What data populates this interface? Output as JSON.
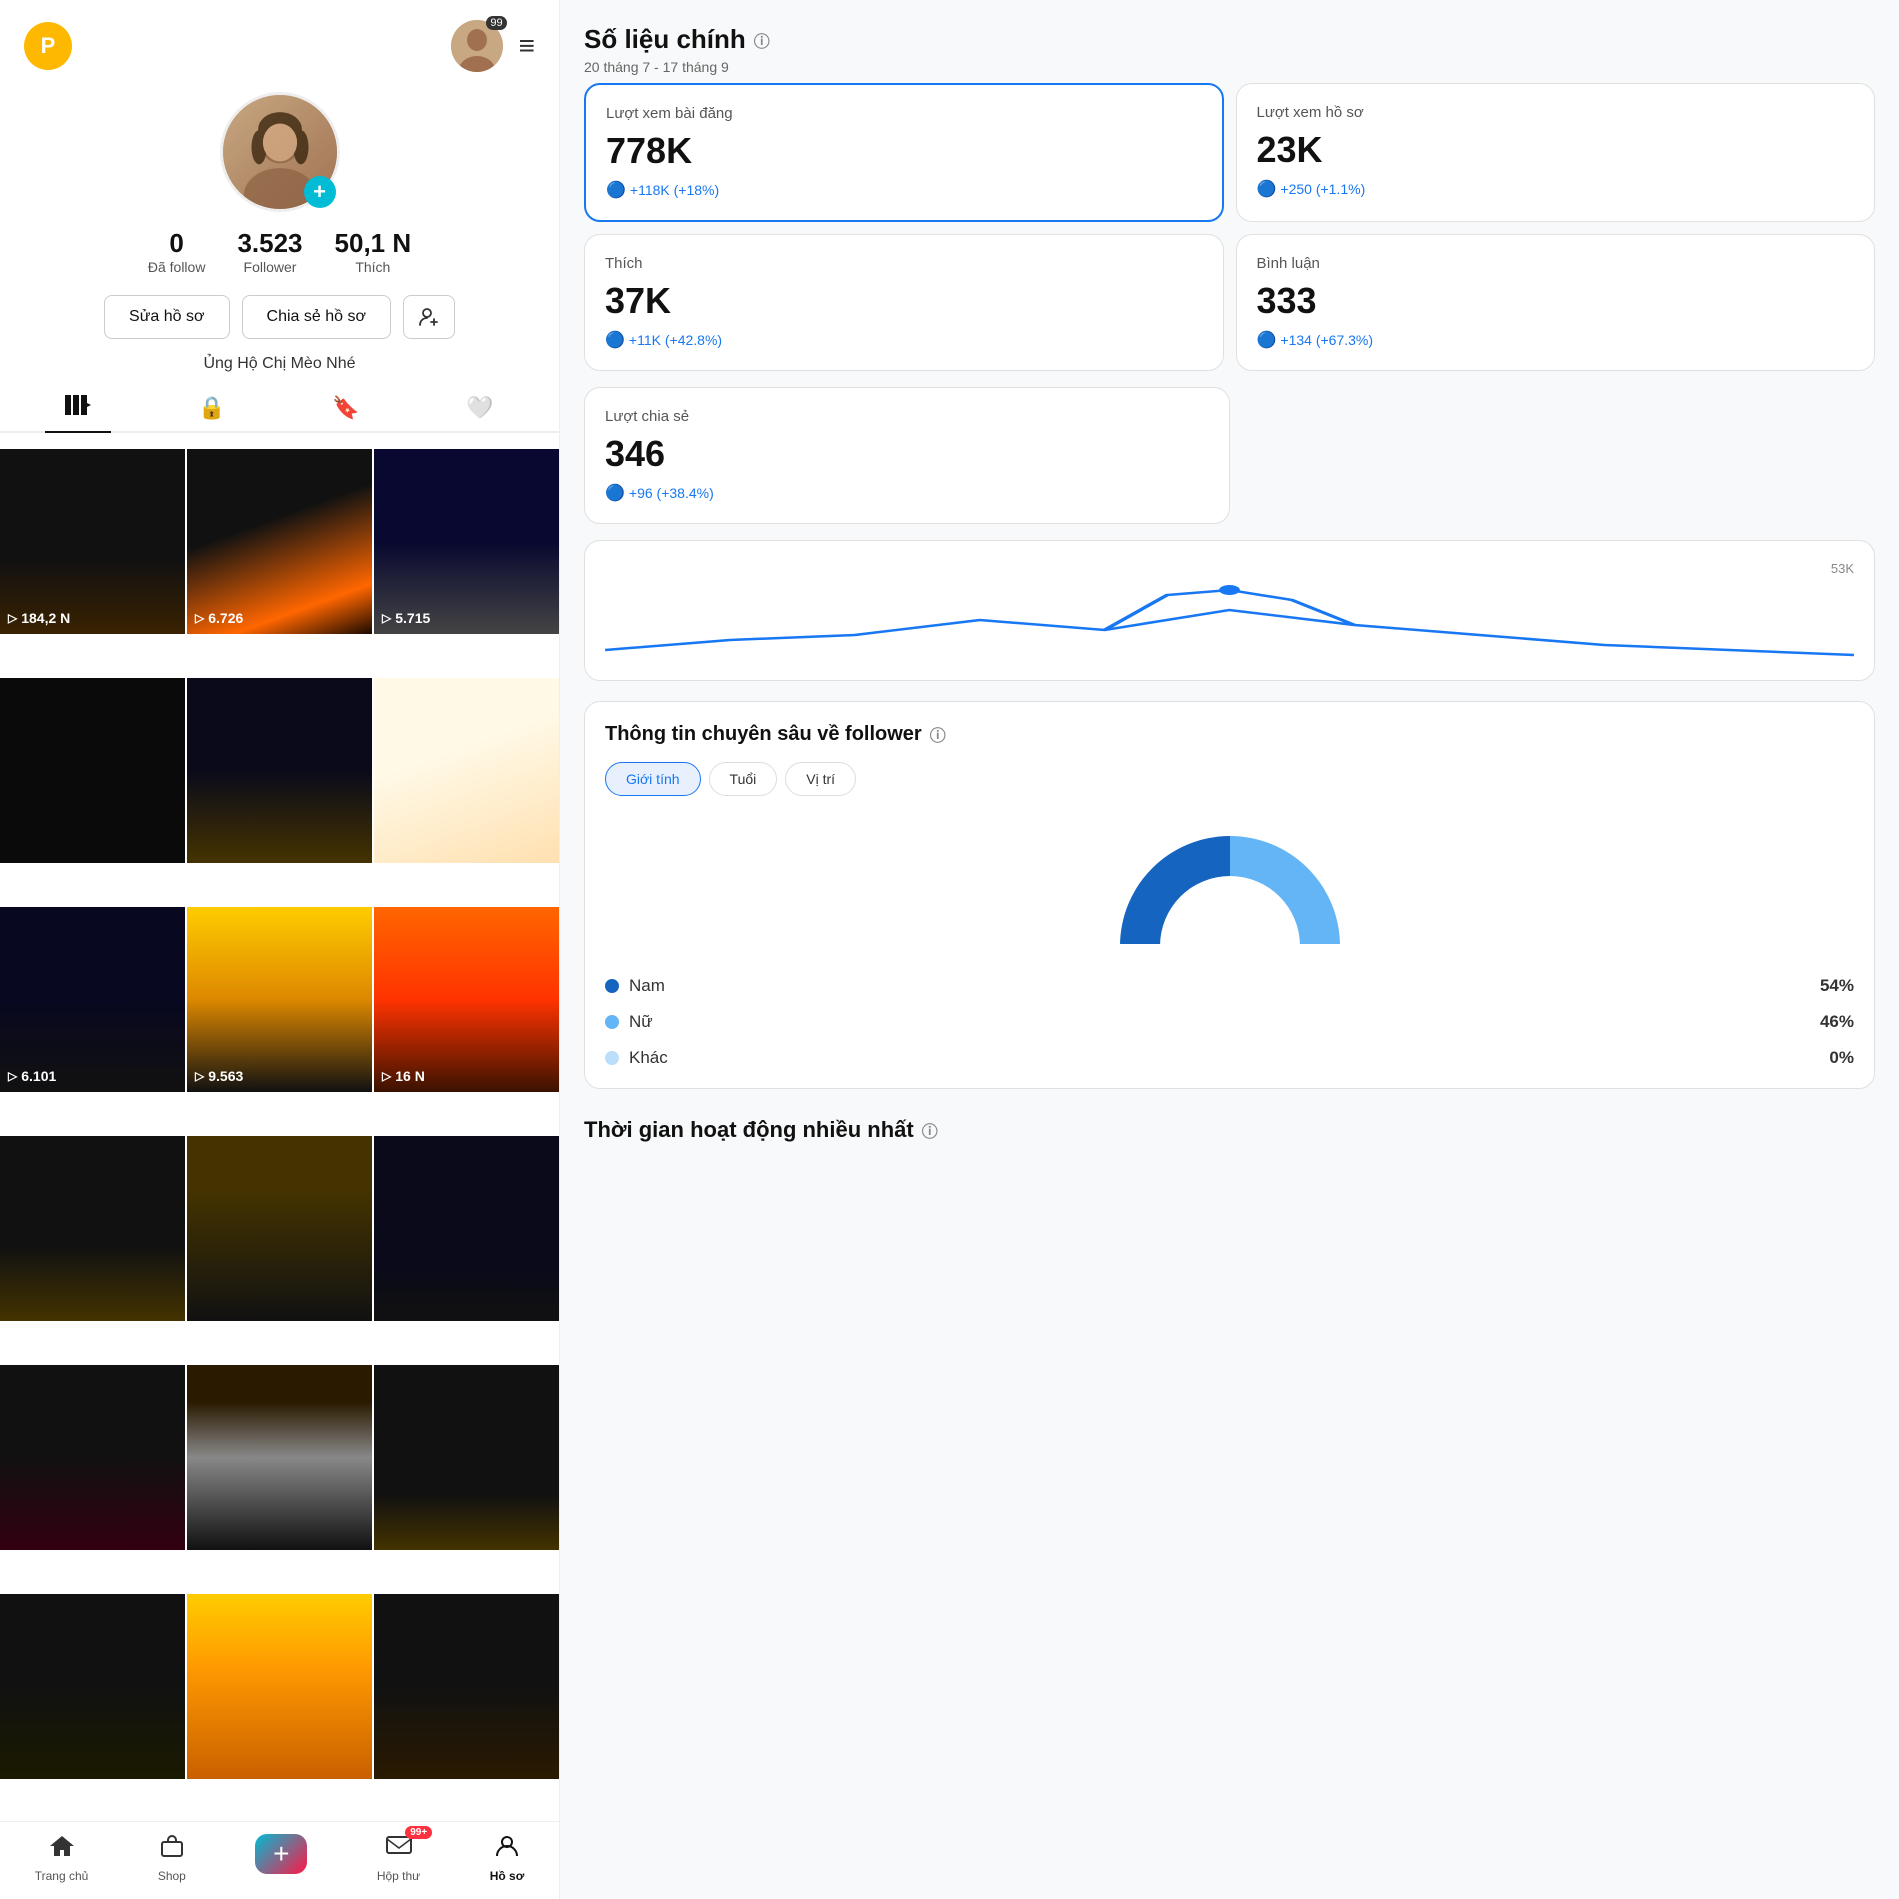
{
  "app": {
    "premium_label": "P",
    "notification_count": "99",
    "hamburger": "≡"
  },
  "profile": {
    "add_button": "+",
    "stats": {
      "follow_value": "0",
      "follow_label": "Đã follow",
      "follower_value": "3.523",
      "follower_label": "Follower",
      "likes_value": "50,1 N",
      "likes_label": "Thích"
    },
    "buttons": {
      "edit": "Sửa hồ sơ",
      "share": "Chia sẻ hồ sơ",
      "add_friend": "👤+"
    },
    "bio": "Ủng Hộ Chị Mèo Nhé",
    "tabs": [
      "|||▾",
      "🔒",
      "🔖",
      "❤"
    ]
  },
  "videos": [
    {
      "count": "184,2 N",
      "class": "vc1"
    },
    {
      "count": "6.726",
      "class": "vc2"
    },
    {
      "count": "5.715",
      "class": "vc3"
    },
    {
      "count": "",
      "class": "vc4"
    },
    {
      "count": "",
      "class": "vc5"
    },
    {
      "count": "",
      "class": "vc6"
    },
    {
      "count": "6.101",
      "class": "vc7"
    },
    {
      "count": "9.563",
      "class": "vc8"
    },
    {
      "count": "16 N",
      "class": "vc9"
    },
    {
      "count": "",
      "class": "vc10"
    },
    {
      "count": "",
      "class": "vc11"
    },
    {
      "count": "",
      "class": "vc12"
    },
    {
      "count": "",
      "class": "vc13"
    },
    {
      "count": "",
      "class": "vc14"
    },
    {
      "count": "",
      "class": "vc15"
    },
    {
      "count": "",
      "class": "vc16"
    },
    {
      "count": "",
      "class": "vc17"
    },
    {
      "count": "",
      "class": "vc18"
    }
  ],
  "bottom_nav": [
    {
      "icon": "🏠",
      "label": "Trang chủ",
      "active": false
    },
    {
      "icon": "🛍",
      "label": "Shop",
      "active": false
    },
    {
      "icon": "+",
      "label": "",
      "active": false,
      "is_plus": true
    },
    {
      "icon": "📬",
      "label": "Hộp thư",
      "active": false,
      "badge": "99+"
    },
    {
      "icon": "👤",
      "label": "Hồ sơ",
      "active": true
    }
  ],
  "right": {
    "section_title": "Số liệu chính",
    "date_range": "20 tháng 7 - 17 tháng 9",
    "metrics": [
      {
        "label": "Lượt xem bài đăng",
        "value": "778K",
        "change": "+118K (+18%)",
        "highlighted": true
      },
      {
        "label": "Lượt xem hồ sơ",
        "value": "23K",
        "change": "+250 (+1.1%)",
        "highlighted": false
      },
      {
        "label": "Thích",
        "value": "37K",
        "change": "+11K (+42.8%)",
        "highlighted": false
      },
      {
        "label": "Bình luận",
        "value": "333",
        "change": "+134 (+67.3%)",
        "highlighted": false
      }
    ],
    "share_metric": {
      "label": "Lượt chia sẻ",
      "value": "346",
      "change": "+96 (+38.4%)"
    },
    "chart_y_label": "53K",
    "follower_section": {
      "title": "Thông tin chuyên sâu về follower",
      "filter_tabs": [
        "Giới tính",
        "Tuổi",
        "Vị trí"
      ],
      "gender_data": [
        {
          "label": "Nam",
          "pct": "54%",
          "color": "#1565C0"
        },
        {
          "label": "Nữ",
          "pct": "46%",
          "color": "#64B5F6"
        },
        {
          "label": "Khác",
          "pct": "0%",
          "color": "#BBDEFB"
        }
      ]
    },
    "active_section_title": "Thời gian hoạt động nhiều nhất"
  }
}
